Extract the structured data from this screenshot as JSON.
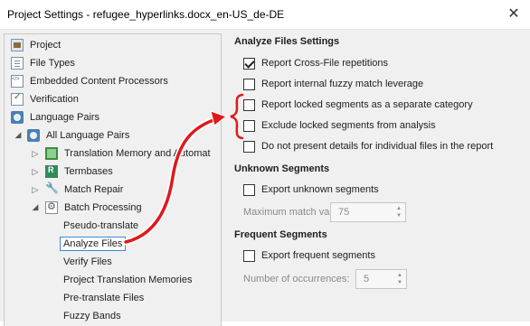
{
  "window": {
    "title": "Project Settings - refugee_hyperlinks.docx_en-US_de-DE"
  },
  "tree": {
    "items": [
      {
        "label": "Project",
        "icon": "project-icon"
      },
      {
        "label": "File Types",
        "icon": "file-types-icon"
      },
      {
        "label": "Embedded Content Processors",
        "icon": "embedded-content-icon"
      },
      {
        "label": "Verification",
        "icon": "verification-icon"
      },
      {
        "label": "Language Pairs",
        "icon": "language-pairs-icon"
      },
      {
        "label": "All Language Pairs",
        "icon": "language-pair-icon"
      },
      {
        "label": "Translation Memory and Automat",
        "icon": "translation-memory-icon"
      },
      {
        "label": "Termbases",
        "icon": "termbase-icon"
      },
      {
        "label": "Match Repair",
        "icon": "wrench-icon"
      },
      {
        "label": "Batch Processing",
        "icon": "batch-processing-icon"
      },
      {
        "label": "Pseudo-translate"
      },
      {
        "label": "Analyze Files"
      },
      {
        "label": "Verify Files"
      },
      {
        "label": "Project Translation Memories"
      },
      {
        "label": "Pre-translate Files"
      },
      {
        "label": "Fuzzy Bands"
      }
    ]
  },
  "settings": {
    "analyze_title": "Analyze Files Settings",
    "analyze_options": [
      {
        "label": "Report Cross-File repetitions",
        "checked": true
      },
      {
        "label": "Report internal fuzzy match leverage",
        "checked": false
      },
      {
        "label": "Report locked segments as a separate category",
        "checked": false
      },
      {
        "label": "Exclude locked segments from analysis",
        "checked": false
      },
      {
        "label": "Do not present details for individual files in the report",
        "checked": false
      }
    ],
    "unknown_title": "Unknown Segments",
    "unknown_export_label": "Export unknown segments",
    "unknown_export_checked": false,
    "max_match_label": "Maximum match value:",
    "max_match_value": "75",
    "frequent_title": "Frequent Segments",
    "frequent_export_label": "Export frequent segments",
    "frequent_export_checked": false,
    "occurrences_label": "Number of occurrences:",
    "occurrences_value": "5"
  },
  "colors": {
    "annotation_arrow": "#e0191b",
    "selection_border": "#3b8bd8"
  }
}
